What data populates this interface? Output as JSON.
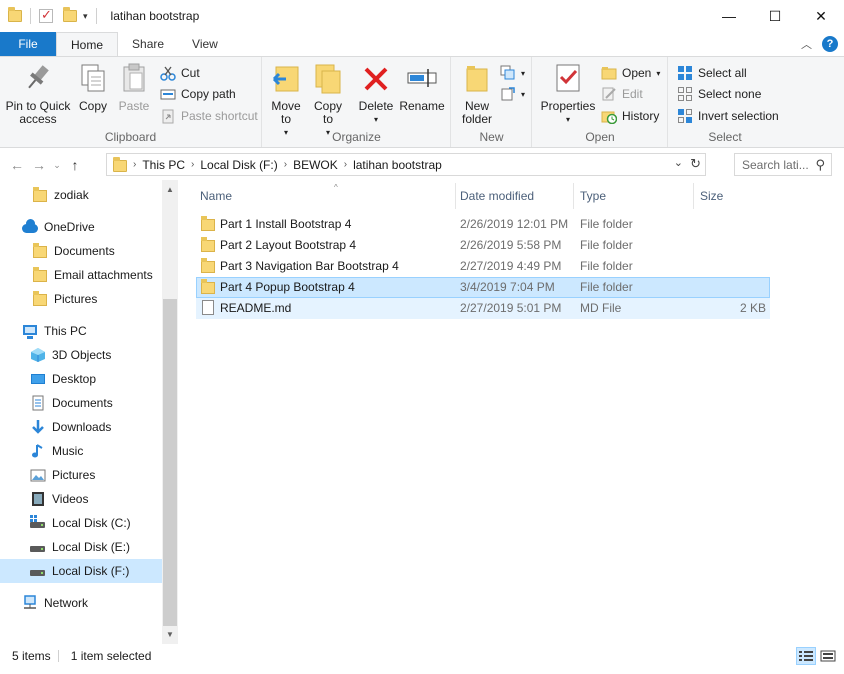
{
  "window": {
    "title": "latihan bootstrap",
    "minimize": "—",
    "maximize": "☐",
    "close": "✕"
  },
  "tabs": [
    "File",
    "Home",
    "Share",
    "View"
  ],
  "ribbon": {
    "clipboard": {
      "label": "Clipboard",
      "pin": "Pin to Quick access",
      "copy": "Copy",
      "paste": "Paste",
      "cut": "Cut",
      "copy_path": "Copy path",
      "paste_shortcut": "Paste shortcut"
    },
    "organize": {
      "label": "Organize",
      "move_to": "Move to",
      "copy_to": "Copy to",
      "delete": "Delete",
      "rename": "Rename"
    },
    "new": {
      "label": "New",
      "new_folder": "New folder"
    },
    "open": {
      "label": "Open",
      "properties": "Properties",
      "open": "Open",
      "edit": "Edit",
      "history": "History"
    },
    "select": {
      "label": "Select",
      "select_all": "Select all",
      "select_none": "Select none",
      "invert": "Invert selection"
    }
  },
  "address": {
    "crumbs": [
      "This PC",
      "Local Disk (F:)",
      "BEWOK",
      "latihan bootstrap"
    ],
    "search_placeholder": "Search lati..."
  },
  "nav": {
    "items": [
      {
        "label": "zodiak",
        "icon": "folder-icon"
      },
      {
        "label": "OneDrive",
        "icon": "onedrive-icon"
      },
      {
        "label": "Documents",
        "icon": "folder-icon"
      },
      {
        "label": "Email attachments",
        "icon": "folder-icon"
      },
      {
        "label": "Pictures",
        "icon": "folder-icon"
      },
      {
        "label": "This PC",
        "icon": "pc-icon"
      },
      {
        "label": "3D Objects",
        "icon": "cube-icon"
      },
      {
        "label": "Desktop",
        "icon": "desktop-icon"
      },
      {
        "label": "Documents",
        "icon": "documents-icon"
      },
      {
        "label": "Downloads",
        "icon": "downloads-icon"
      },
      {
        "label": "Music",
        "icon": "music-icon"
      },
      {
        "label": "Pictures",
        "icon": "pictures-icon"
      },
      {
        "label": "Videos",
        "icon": "videos-icon"
      },
      {
        "label": "Local Disk (C:)",
        "icon": "drive-icon"
      },
      {
        "label": "Local Disk (E:)",
        "icon": "drive-icon"
      },
      {
        "label": "Local Disk (F:)",
        "icon": "drive-icon"
      },
      {
        "label": "Network",
        "icon": "network-icon"
      }
    ]
  },
  "columns": [
    "Name",
    "Date modified",
    "Type",
    "Size"
  ],
  "files": [
    {
      "name": "Part 1 Install Bootstrap 4",
      "date": "2/26/2019 12:01 PM",
      "type": "File folder",
      "size": ""
    },
    {
      "name": "Part 2 Layout Bootstrap 4",
      "date": "2/26/2019 5:58 PM",
      "type": "File folder",
      "size": ""
    },
    {
      "name": "Part 3 Navigation Bar Bootstrap 4",
      "date": "2/27/2019 4:49 PM",
      "type": "File folder",
      "size": ""
    },
    {
      "name": "Part 4 Popup Bootstrap 4",
      "date": "3/4/2019 7:04 PM",
      "type": "File folder",
      "size": ""
    },
    {
      "name": "README.md",
      "date": "2/27/2019 5:01 PM",
      "type": "MD File",
      "size": "2 KB"
    }
  ],
  "status": {
    "count": "5 items",
    "selected": "1 item selected"
  },
  "colors": {
    "accent": "#1979ca",
    "selection": "#cce8ff",
    "folder": "#f8d775"
  }
}
